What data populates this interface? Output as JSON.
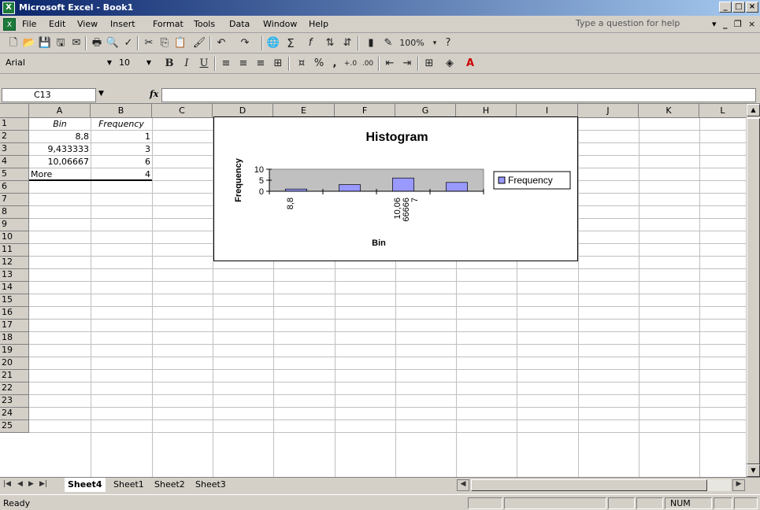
{
  "window": {
    "title": "Microsoft Excel - Book1",
    "controls": [
      "_",
      "□",
      "×"
    ]
  },
  "menu": {
    "items": [
      "File",
      "Edit",
      "View",
      "Insert",
      "Format",
      "Tools",
      "Data",
      "Window",
      "Help"
    ],
    "help_placeholder": "Type a question for help"
  },
  "standard_toolbar": {
    "zoom": "100%"
  },
  "formatting_toolbar": {
    "font": "Arial",
    "size": "10"
  },
  "formula_bar": {
    "name_box": "C13",
    "fx": "fx",
    "value": ""
  },
  "columns": [
    "A",
    "B",
    "C",
    "D",
    "E",
    "F",
    "G",
    "H",
    "I",
    "J",
    "K",
    "L"
  ],
  "rows": [
    "1",
    "2",
    "3",
    "4",
    "5",
    "6",
    "7",
    "8",
    "9",
    "10",
    "11",
    "12",
    "13",
    "14",
    "15",
    "16",
    "17",
    "18",
    "19",
    "20",
    "21",
    "22",
    "23",
    "24",
    "25"
  ],
  "cells": {
    "A1": "Bin",
    "B1": "Frequency",
    "A2": "8,8",
    "B2": "1",
    "A3": "9,433333",
    "B3": "3",
    "A4": "10,06667",
    "B4": "6",
    "A5": "More",
    "B5": "4"
  },
  "chart_data": {
    "type": "bar",
    "title": "Histogram",
    "xlabel": "Bin",
    "ylabel": "Frequency",
    "categories": [
      "8,8",
      "9,433333",
      "10,06667",
      "More"
    ],
    "visible_tick_labels": [
      "8,8",
      "10,06\n66666\n7"
    ],
    "series": [
      {
        "name": "Frequency",
        "values": [
          1,
          3,
          6,
          4
        ],
        "color": "#9999ff"
      }
    ],
    "ylim": [
      0,
      10
    ],
    "yticks": [
      "10",
      "5",
      "0"
    ],
    "plot_bg": "#c0c0c0",
    "legend": "right"
  },
  "sheet_tabs": [
    "Sheet4",
    "Sheet1",
    "Sheet2",
    "Sheet3"
  ],
  "active_sheet": "Sheet4",
  "status": {
    "text": "Ready",
    "num": "NUM"
  }
}
